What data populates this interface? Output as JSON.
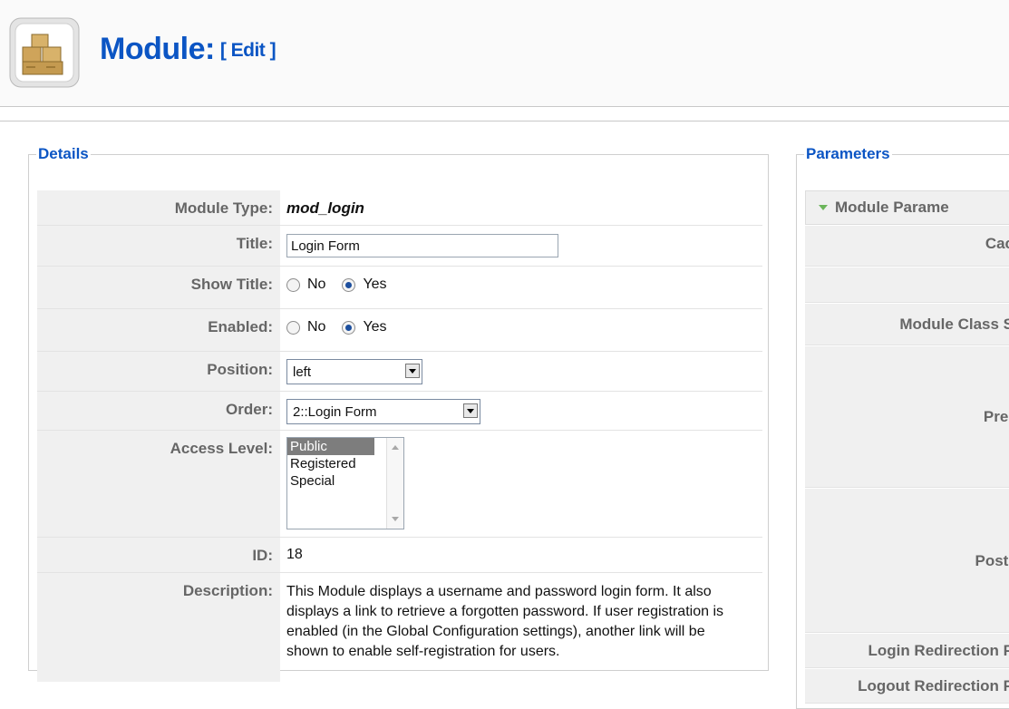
{
  "header": {
    "title": "Module:",
    "subtitle": "[ Edit ]",
    "icon": "module-box-icon"
  },
  "details": {
    "legend": "Details",
    "module_type": {
      "label": "Module Type:",
      "value": "mod_login"
    },
    "title": {
      "label": "Title:",
      "value": "Login Form"
    },
    "show_title": {
      "label": "Show Title:",
      "options": [
        "No",
        "Yes"
      ],
      "selected": "Yes"
    },
    "enabled": {
      "label": "Enabled:",
      "options": [
        "No",
        "Yes"
      ],
      "selected": "Yes"
    },
    "position": {
      "label": "Position:",
      "value": "left"
    },
    "order": {
      "label": "Order:",
      "value": "2::Login Form"
    },
    "access_level": {
      "label": "Access Level:",
      "options": [
        "Public",
        "Registered",
        "Special"
      ],
      "selected": "Public"
    },
    "id": {
      "label": "ID:",
      "value": "18"
    },
    "description": {
      "label": "Description:",
      "value": "This Module displays a username and password login form. It also displays a link to retrieve a forgotten password. If user registration is enabled (in the Global Configuration settings), another link will be shown to enable self-registration for users."
    }
  },
  "parameters": {
    "legend": "Parameters",
    "section_title": "Module Parame",
    "labels": [
      "Cac",
      "Module Class S",
      "Pre-",
      "Post-",
      "Login Redirection P",
      "Logout Redirection P"
    ]
  }
}
